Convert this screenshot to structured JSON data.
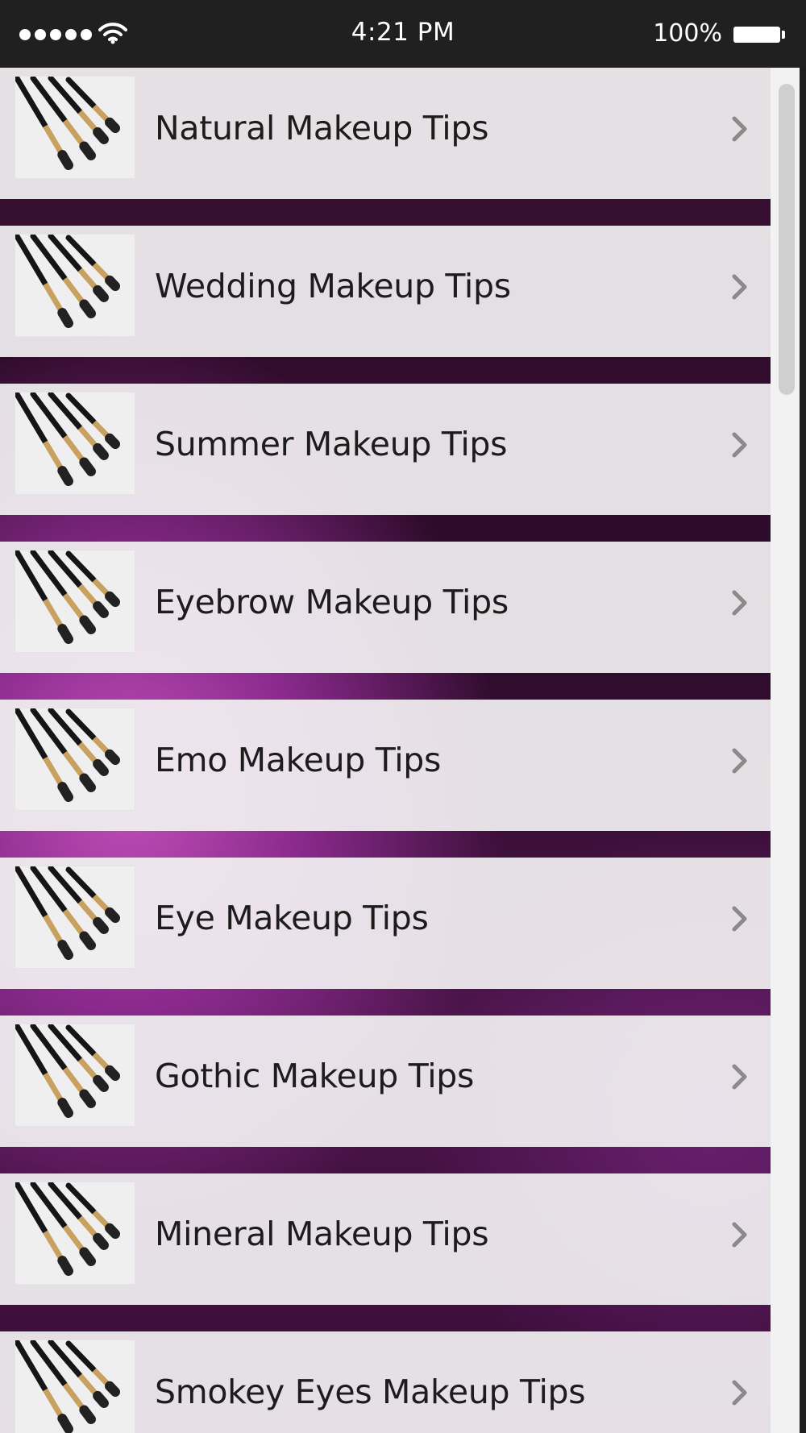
{
  "status_bar": {
    "time": "4:21 PM",
    "battery_percent": "100%",
    "signal_bars": 5,
    "icons": [
      "signal-dots-icon",
      "wifi-icon",
      "battery-icon"
    ]
  },
  "menu": {
    "items": [
      {
        "label": "Natural Makeup Tips",
        "thumb_icon": "makeup-brushes-icon",
        "chevron_icon": "chevron-right-icon"
      },
      {
        "label": "Wedding Makeup Tips",
        "thumb_icon": "makeup-brushes-icon",
        "chevron_icon": "chevron-right-icon"
      },
      {
        "label": "Summer Makeup Tips",
        "thumb_icon": "makeup-brushes-icon",
        "chevron_icon": "chevron-right-icon"
      },
      {
        "label": "Eyebrow Makeup Tips",
        "thumb_icon": "makeup-brushes-icon",
        "chevron_icon": "chevron-right-icon"
      },
      {
        "label": "Emo Makeup Tips",
        "thumb_icon": "makeup-brushes-icon",
        "chevron_icon": "chevron-right-icon"
      },
      {
        "label": "Eye Makeup Tips",
        "thumb_icon": "makeup-brushes-icon",
        "chevron_icon": "chevron-right-icon"
      },
      {
        "label": "Gothic Makeup Tips",
        "thumb_icon": "makeup-brushes-icon",
        "chevron_icon": "chevron-right-icon"
      },
      {
        "label": "Mineral Makeup Tips",
        "thumb_icon": "makeup-brushes-icon",
        "chevron_icon": "chevron-right-icon"
      },
      {
        "label": "Smokey Eyes Makeup Tips",
        "thumb_icon": "makeup-brushes-icon",
        "chevron_icon": "chevron-right-icon"
      }
    ]
  },
  "colors": {
    "status_bar_bg": "#202020",
    "row_bg": "#f2f0f2",
    "text": "#1c1c1c",
    "chevron": "#8a8a8a",
    "divider_purple": "#5a1a58",
    "accent_magenta": "#c04fb8"
  }
}
